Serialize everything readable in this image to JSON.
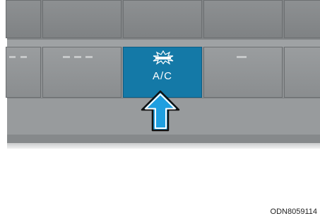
{
  "panel": {
    "active_button": {
      "label": "A/C",
      "indicator": "indicator-light-icon",
      "color": "#1479a7"
    },
    "other_buttons": [
      {
        "symbol": "- -"
      },
      {
        "symbol": "- - -"
      },
      {
        "symbol": "-"
      }
    ]
  },
  "annotation": {
    "arrow": "up-arrow-icon",
    "arrow_color": "#1f9fe0"
  },
  "figure_code": "ODN8059114"
}
